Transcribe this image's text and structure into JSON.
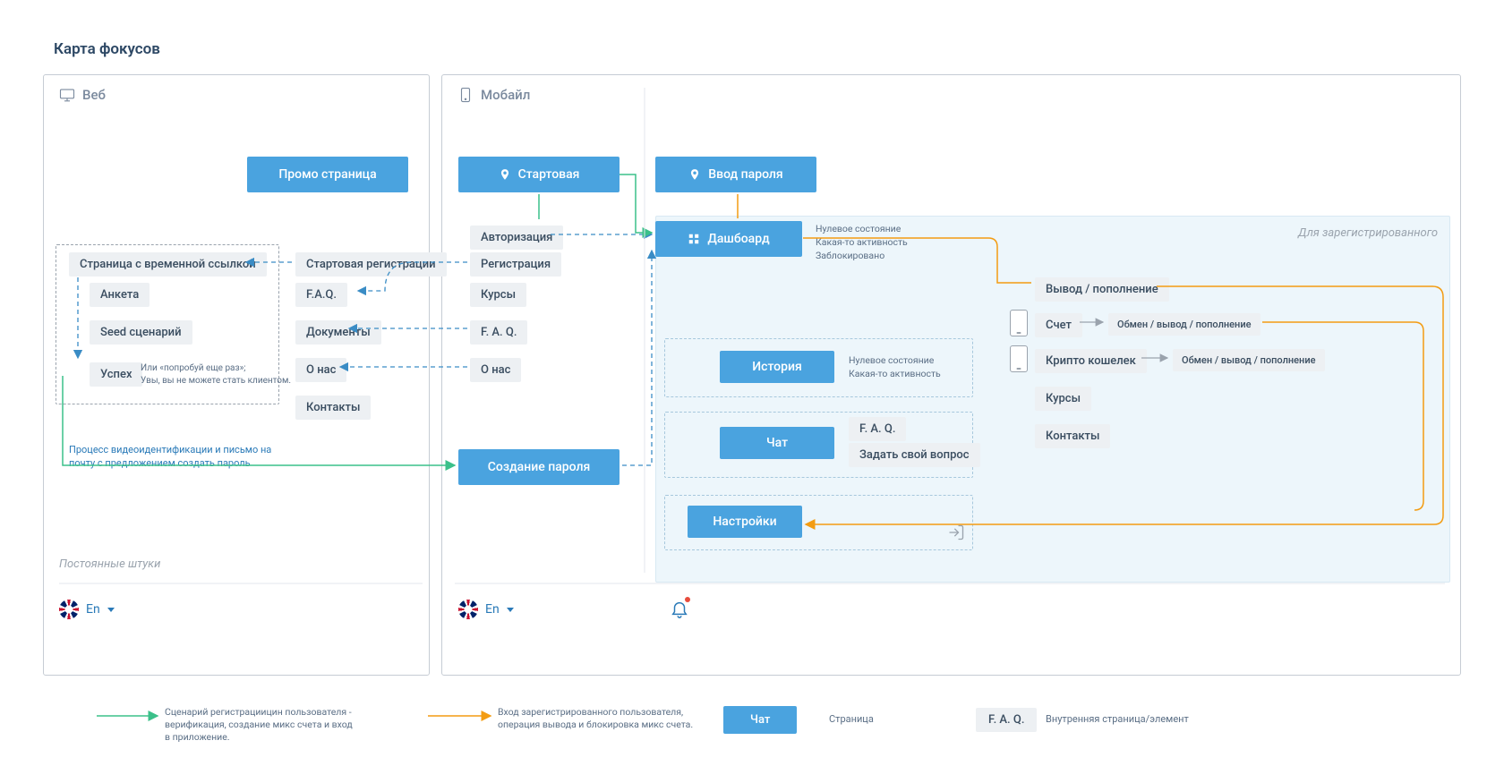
{
  "title": "Карта фокусов",
  "panels": {
    "web": {
      "title": "Веб"
    },
    "mobile": {
      "title": "Мобайл"
    }
  },
  "web": {
    "promo": "Промо страница",
    "tempLinkBox": {
      "title": "Страница с временной ссылкой",
      "anketa": "Анкета",
      "seed": "Seed сценарий",
      "success": "Успех",
      "successNote": "Или  «попробуй еще раз»;\nУвы, вы не можете стать клиентом."
    },
    "startReg": "Стартовая регистрации",
    "faq": "F.A.Q.",
    "docs": "Документы",
    "about": "О нас",
    "contacts": "Контакты",
    "processNote": "Процесс видеоидентификации и письмо на\nпочту с предложением создать пароль",
    "permanentLabel": "Постоянные штуки",
    "lang": "En"
  },
  "mobile": {
    "start": "Стартовая",
    "auth": "Авторизация",
    "reg": "Регистрация",
    "courses": "Курсы",
    "faq": "F. A. Q.",
    "about": "О нас",
    "createPassword": "Создание пароля",
    "lang": "En",
    "enterPassword": "Ввод пароля",
    "dashboard": "Дашбоард",
    "dashboardStates": "Нулевое состояние\nКакая-то активность\nЗаблокировано",
    "forRegistered": "Для зарегистрированного",
    "history": "История",
    "historyStates": "Нулевое состояние\nКакая-то активность",
    "chat": "Чат",
    "chatFaq": "F. A. Q.",
    "chatAsk": "Задать свой вопрос",
    "settings": "Настройки",
    "withdraw": "Вывод / пополнение",
    "account": "Счет",
    "accountOps": "Обмен / вывод / пополнение",
    "crypto": "Крипто кошелек",
    "cryptoOps": "Обмен / вывод / пополнение",
    "courses2": "Курсы",
    "contacts2": "Контакты"
  },
  "legend": {
    "green": "Сценарий регистрациицин пользователя -\nверификация, создание микс счета и вход\nв приложение.",
    "orange": "Вход зарегистрированного пользователя,\nоперация вывода и блокировка микс счета.",
    "chat": "Чат",
    "page": "Страница",
    "faq": "F. A. Q.",
    "inner": "Внутренняя страница/элемент"
  }
}
